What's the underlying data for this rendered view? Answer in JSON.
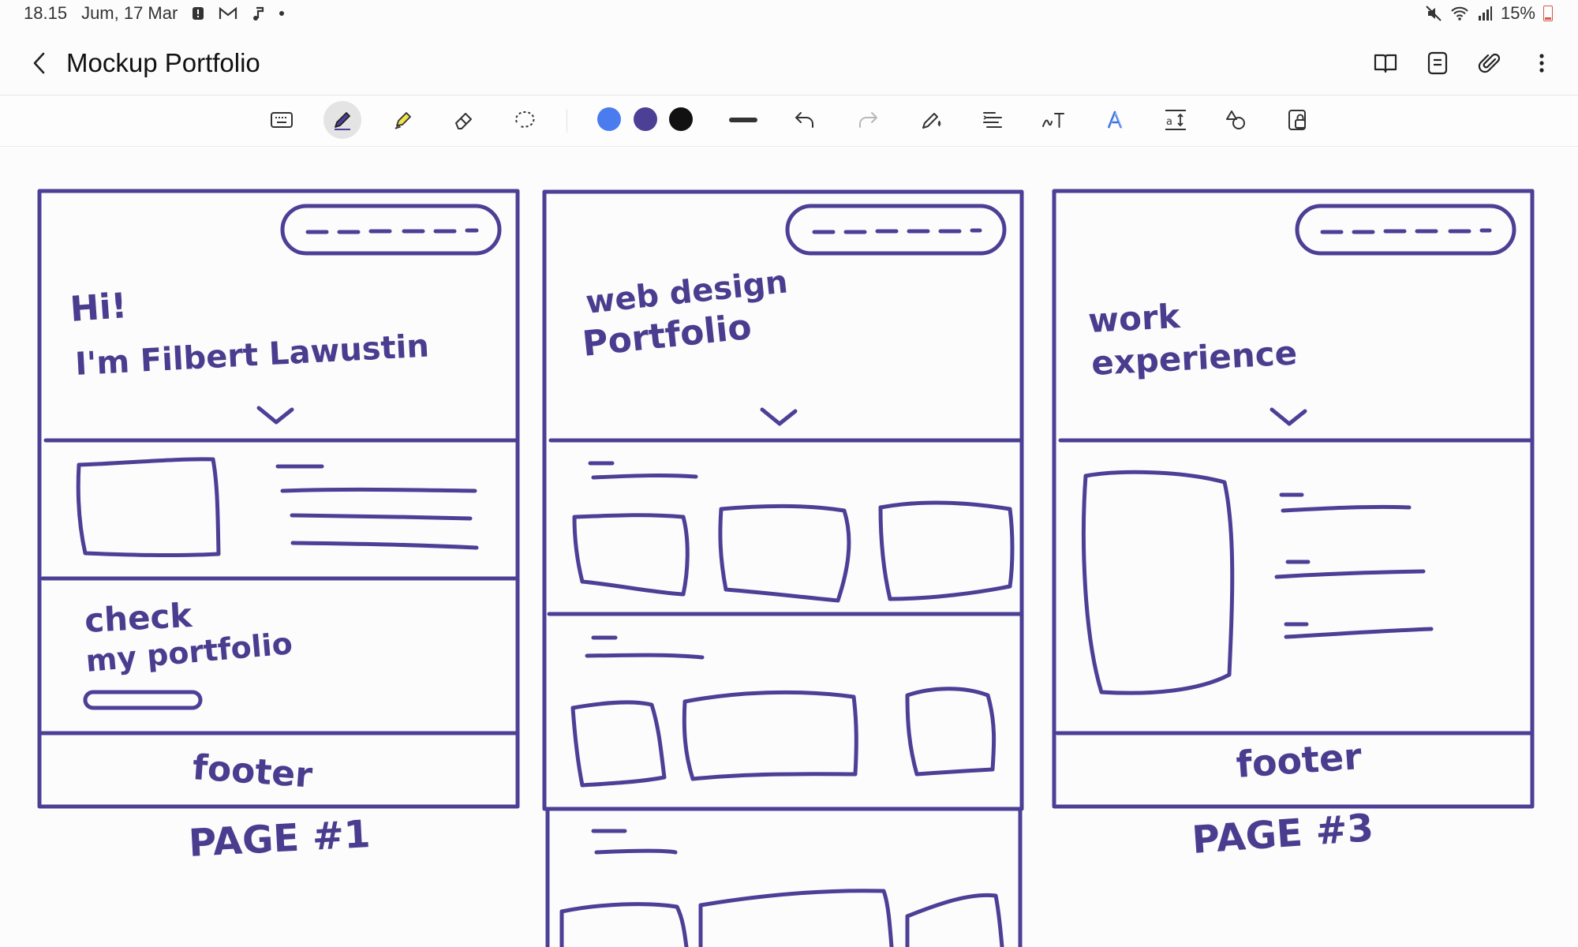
{
  "status_bar": {
    "time": "18.15",
    "date": "Jum, 17 Mar",
    "battery": "15%"
  },
  "header": {
    "title": "Mockup Portfolio"
  },
  "toolbar": {
    "tools": [
      "keyboard-icon",
      "pen-icon",
      "highlighter-icon",
      "eraser-icon",
      "lasso-icon"
    ],
    "colors": [
      "#4a7cf0",
      "#4c3f96",
      "#111111"
    ],
    "actions": [
      "undo-icon",
      "redo-icon",
      "pen-settings-icon",
      "align-icon",
      "handwriting-to-text-icon",
      "text-style-icon",
      "spacing-icon",
      "shapes-icon",
      "lock-icon"
    ]
  },
  "sketch": {
    "ink_color": "#4c3f96",
    "page1": {
      "greeting": "Hi!",
      "intro": "I'm Filbert Lawustin",
      "cta_line1": "check",
      "cta_line2": "my portfolio",
      "footer": "footer",
      "caption": "PAGE #1"
    },
    "page2": {
      "heading_line1": "web design",
      "heading_line2": "Portfolio"
    },
    "page3": {
      "heading_line1": "work",
      "heading_line2": "experience",
      "footer": "footer",
      "caption": "PAGE #3"
    }
  }
}
